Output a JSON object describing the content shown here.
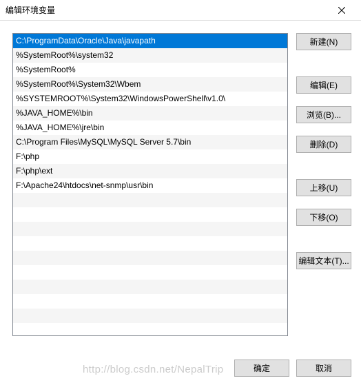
{
  "window": {
    "title": "编辑环境变量"
  },
  "list": {
    "items": [
      "C:\\ProgramData\\Oracle\\Java\\javapath",
      "%SystemRoot%\\system32",
      "%SystemRoot%",
      "%SystemRoot%\\System32\\Wbem",
      "%SYSTEMROOT%\\System32\\WindowsPowerShell\\v1.0\\",
      "%JAVA_HOME%\\bin",
      "%JAVA_HOME%\\jre\\bin",
      "C:\\Program Files\\MySQL\\MySQL Server 5.7\\bin",
      "F:\\php",
      "F:\\php\\ext",
      "F:\\Apache24\\htdocs\\net-snmp\\usr\\bin"
    ],
    "selected_index": 0
  },
  "buttons": {
    "new": "新建(N)",
    "edit": "编辑(E)",
    "browse": "浏览(B)...",
    "delete": "删除(D)",
    "move_up": "上移(U)",
    "move_down": "下移(O)",
    "edit_text": "编辑文本(T)...",
    "ok": "确定",
    "cancel": "取消"
  },
  "watermark": "http://blog.csdn.net/NepalTrip"
}
